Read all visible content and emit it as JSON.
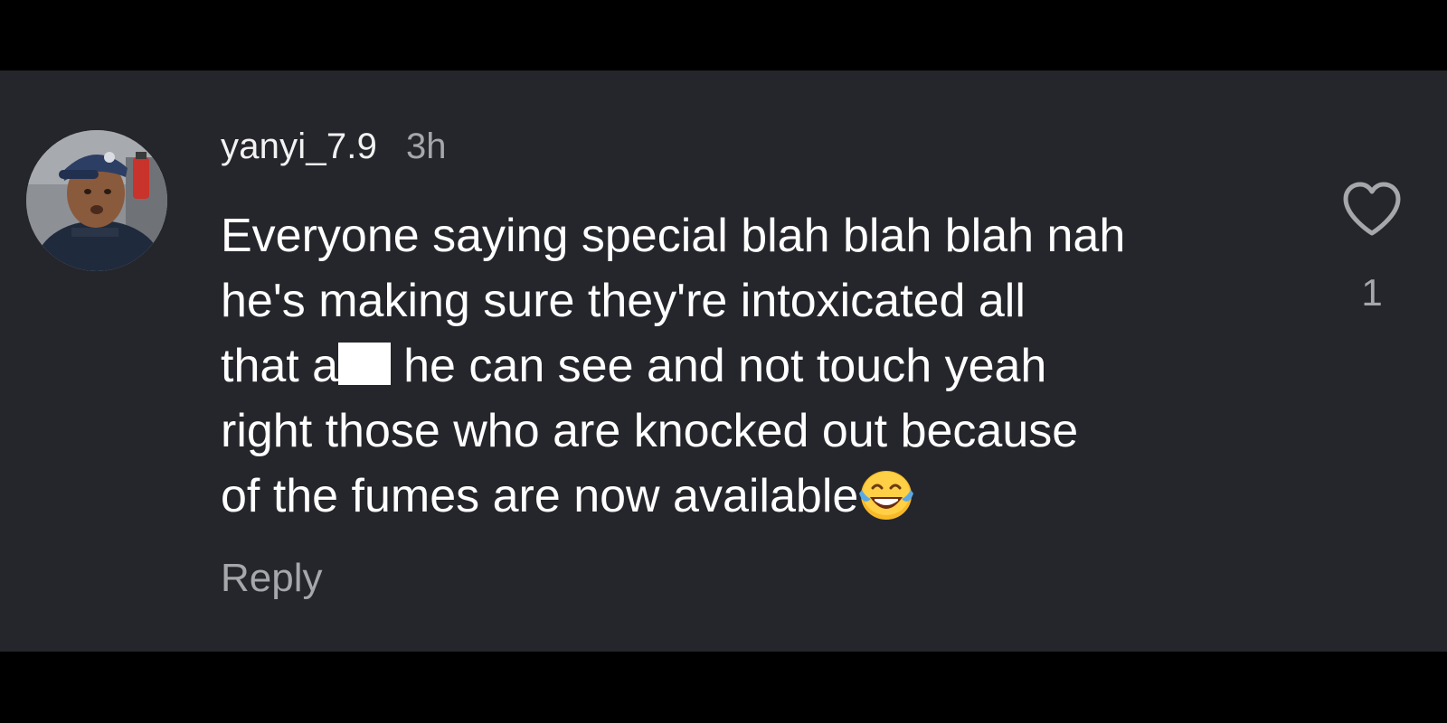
{
  "comment": {
    "username": "yanyi_7.9",
    "timestamp": "3h",
    "text_lines": [
      "Everyone saying special blah blah blah nah",
      "he's making sure they're intoxicated all",
      "that a",
      "he can see and not touch yeah",
      "right those who are knocked out because",
      "of the fumes are now available"
    ],
    "censored_word": "redacted-box",
    "trailing_emoji": "😂",
    "reply_label": "Reply",
    "like_count": "1"
  },
  "icons": {
    "like": "heart-outline-icon",
    "emoji": "face-with-tears-of-joy"
  },
  "colors": {
    "background": "#25262b",
    "text_primary": "#ffffff",
    "text_secondary": "#a6a7ab",
    "letterbox": "#000000"
  }
}
